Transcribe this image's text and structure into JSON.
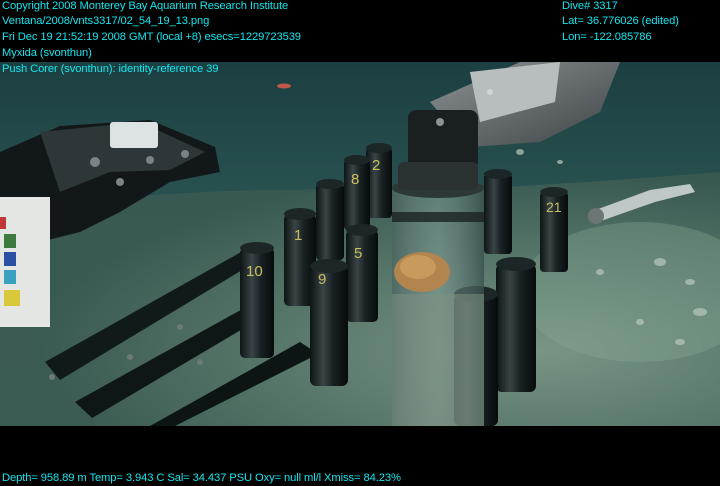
{
  "overlay": {
    "copyright": "Copyright 2008 Monterey Bay Aquarium Research Institute",
    "file_path": "Ventana/2008/vnts3317/02_54_19_13.png",
    "datetime": "Fri Dec 19 21:52:19 2008 GMT (local +8)  esecs=1229723539",
    "observer": "Myxida (svonthun)",
    "annotation": "Push Corer (svonthun): identity-reference 39",
    "dive": "Dive# 3317",
    "lat": "Lat= 36.776026 (edited)",
    "lon": "Lon= -122.085786",
    "telemetry": "Depth= 958.89 m  Temp= 3.943 C  Sal= 34.437 PSU  Oxy= null ml/l  Xmiss= 84.23%"
  },
  "tube_labels": {
    "t2": "2",
    "t8": "8",
    "t1": "1",
    "t10": "10",
    "t5": "5",
    "t9": "9",
    "t21": "21"
  },
  "colors": {
    "overlay_text": "#14e6ee",
    "water": "#1f4a4a",
    "seafloor": "#5c7a6e"
  }
}
